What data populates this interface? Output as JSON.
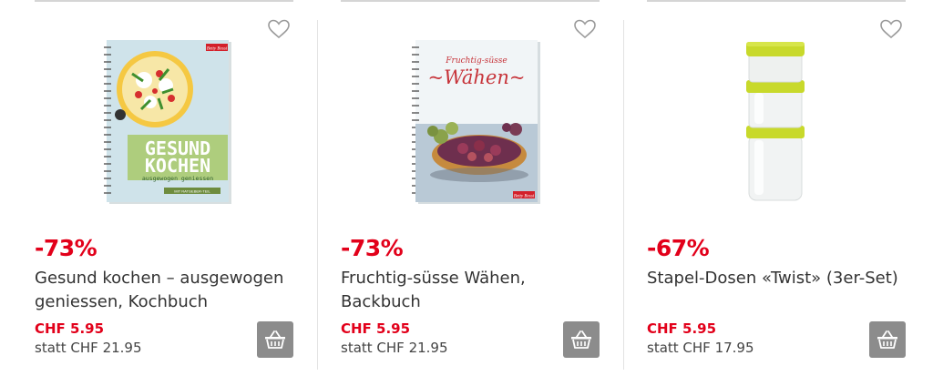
{
  "products": [
    {
      "discount": "-73%",
      "name": "Gesund kochen – ausgewogen geniessen, Kochbuch",
      "price": "CHF 5.95",
      "old_price": "statt CHF 21.95",
      "image": "cookbook-gesund-kochen",
      "cover": {
        "brand": "Betty Bossi",
        "title_line1": "GESUND",
        "title_line2": "KOCHEN",
        "subtitle": "ausgewogen geniessen",
        "tag": "MIT RATGEBER-TEIL"
      }
    },
    {
      "discount": "-73%",
      "name": "Fruchtig-süsse Wähen, Backbuch",
      "price": "CHF 5.95",
      "old_price": "statt CHF 21.95",
      "image": "cookbook-fruchtig-suesse-waehen",
      "cover": {
        "script": "Fruchtig-süsse",
        "title": "~Wähen~",
        "brand": "Betty Bossi"
      }
    },
    {
      "discount": "-67%",
      "name": "Stapel-Dosen «Twist» (3er-Set)",
      "price": "CHF 5.95",
      "old_price": "statt CHF 17.95",
      "image": "stacking-containers-lime-green"
    }
  ],
  "icons": {
    "wishlist": "heart-outline-icon",
    "cart": "basket-icon"
  },
  "colors": {
    "accent_red": "#e2001a",
    "cart_bg": "#8c8c8c",
    "lime": "#c8d92b"
  }
}
